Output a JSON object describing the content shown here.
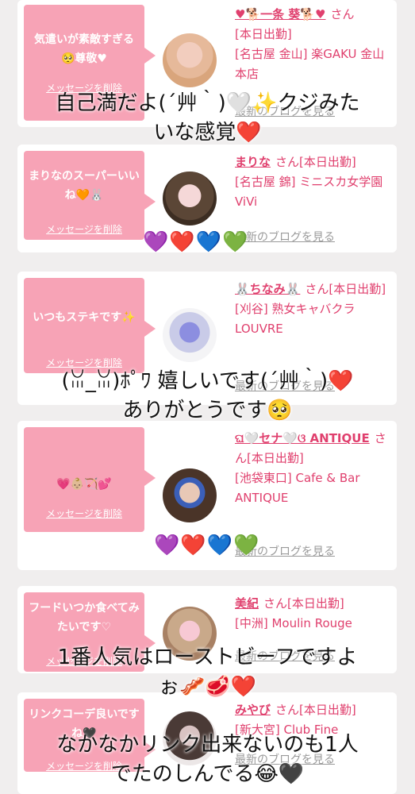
{
  "colors": {
    "accent": "#e0406e",
    "bubble": "#f7a3b6",
    "link_gray": "#9a9a9a"
  },
  "cards": [
    {
      "message": "気遣いが素敵すぎる🥺尊敬♥",
      "delete": "メッセージを削除",
      "name": "♥🐕一条 葵🐕♥",
      "san": "さん",
      "lines": [
        "[本日出勤]",
        "[名古屋 金山] 楽GAKU 金山本店"
      ],
      "blog": "最新のブログを見る",
      "avatar": "avatar-girl-blonde"
    },
    {
      "message": "まりなのスーパーいいね🧡🐰",
      "delete": "メッセージを削除",
      "name": "まりな",
      "san": "さん[本日出勤]",
      "lines": [
        "[名古屋 錦] ミニスカ女学園ViVi"
      ],
      "blog": "最新のブログを見る",
      "avatar": "avatar-girl-brown"
    },
    {
      "message": "いつもステキです✨",
      "delete": "メッセージを削除",
      "name": "🐰ちなみ🐰",
      "san": "さん[本日出勤]",
      "lines": [
        "[刈谷] 熟女キャバクラ LOUVRE"
      ],
      "blog": "最新のブログを見る",
      "avatar": "avatar-flower"
    },
    {
      "message": "💗👶🏼🏹💕",
      "delete": "メッセージを削除",
      "name": "ଘ🤍セナ🤍ଓ ANTIQUE",
      "san": "さん[本日出勤]",
      "lines": [
        "[池袋東口] Cafe & Bar ANTIQUE"
      ],
      "blog": "最新のブログを見る",
      "avatar": "avatar-girl-sena"
    },
    {
      "message": "フードいつか食べてみたいです♡",
      "delete": "メッセージを削除",
      "name": "美紀",
      "san": "さん[本日出勤]",
      "lines": [
        "[中洲] Moulin Rouge"
      ],
      "blog": "最新のブログを見る",
      "avatar": "avatar-girl-miki"
    },
    {
      "message": "リンクコーデ良いですね🖤",
      "delete": "メッセージを削除",
      "name": "みやび",
      "san": "さん[本日出勤]",
      "lines": [
        "[新大宮] Club Fine"
      ],
      "blog": "最新のブログを見る",
      "avatar": "avatar-girl-miyabi"
    }
  ],
  "overlays": [
    {
      "line1": "自己満だよ(´艸｀)🤍✨クジみた",
      "line2": "いな感覚❤️"
    },
    {
      "hearts": "💜❤️💙💚"
    },
    {
      "line1": "(ꈍ_ꈍ)ﾎﾟﾜ 嬉しいです(´艸｀)❤️",
      "line2": "ありがとうです🥺"
    },
    {
      "hearts": "💜❤️💙💚"
    },
    {
      "line1": "1番人気はローストビーフですよ",
      "line2": "ぉ🥓🥩❤️"
    },
    {
      "line1": "なかなかリンク出来ないのも1人",
      "line2": "でたのしんでる😂🖤"
    }
  ]
}
